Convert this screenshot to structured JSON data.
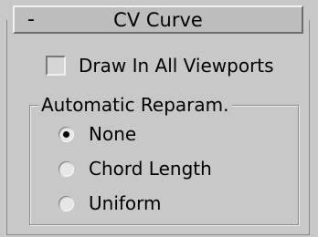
{
  "rollout": {
    "collapse_symbol": "-",
    "title": "CV Curve"
  },
  "draw_all_viewports": {
    "label": "Draw In All Viewports",
    "checked": false
  },
  "reparam_group": {
    "title": "Automatic Reparam.",
    "options": [
      {
        "label": "None",
        "selected": true
      },
      {
        "label": "Chord Length",
        "selected": false
      },
      {
        "label": "Uniform",
        "selected": false
      }
    ]
  }
}
